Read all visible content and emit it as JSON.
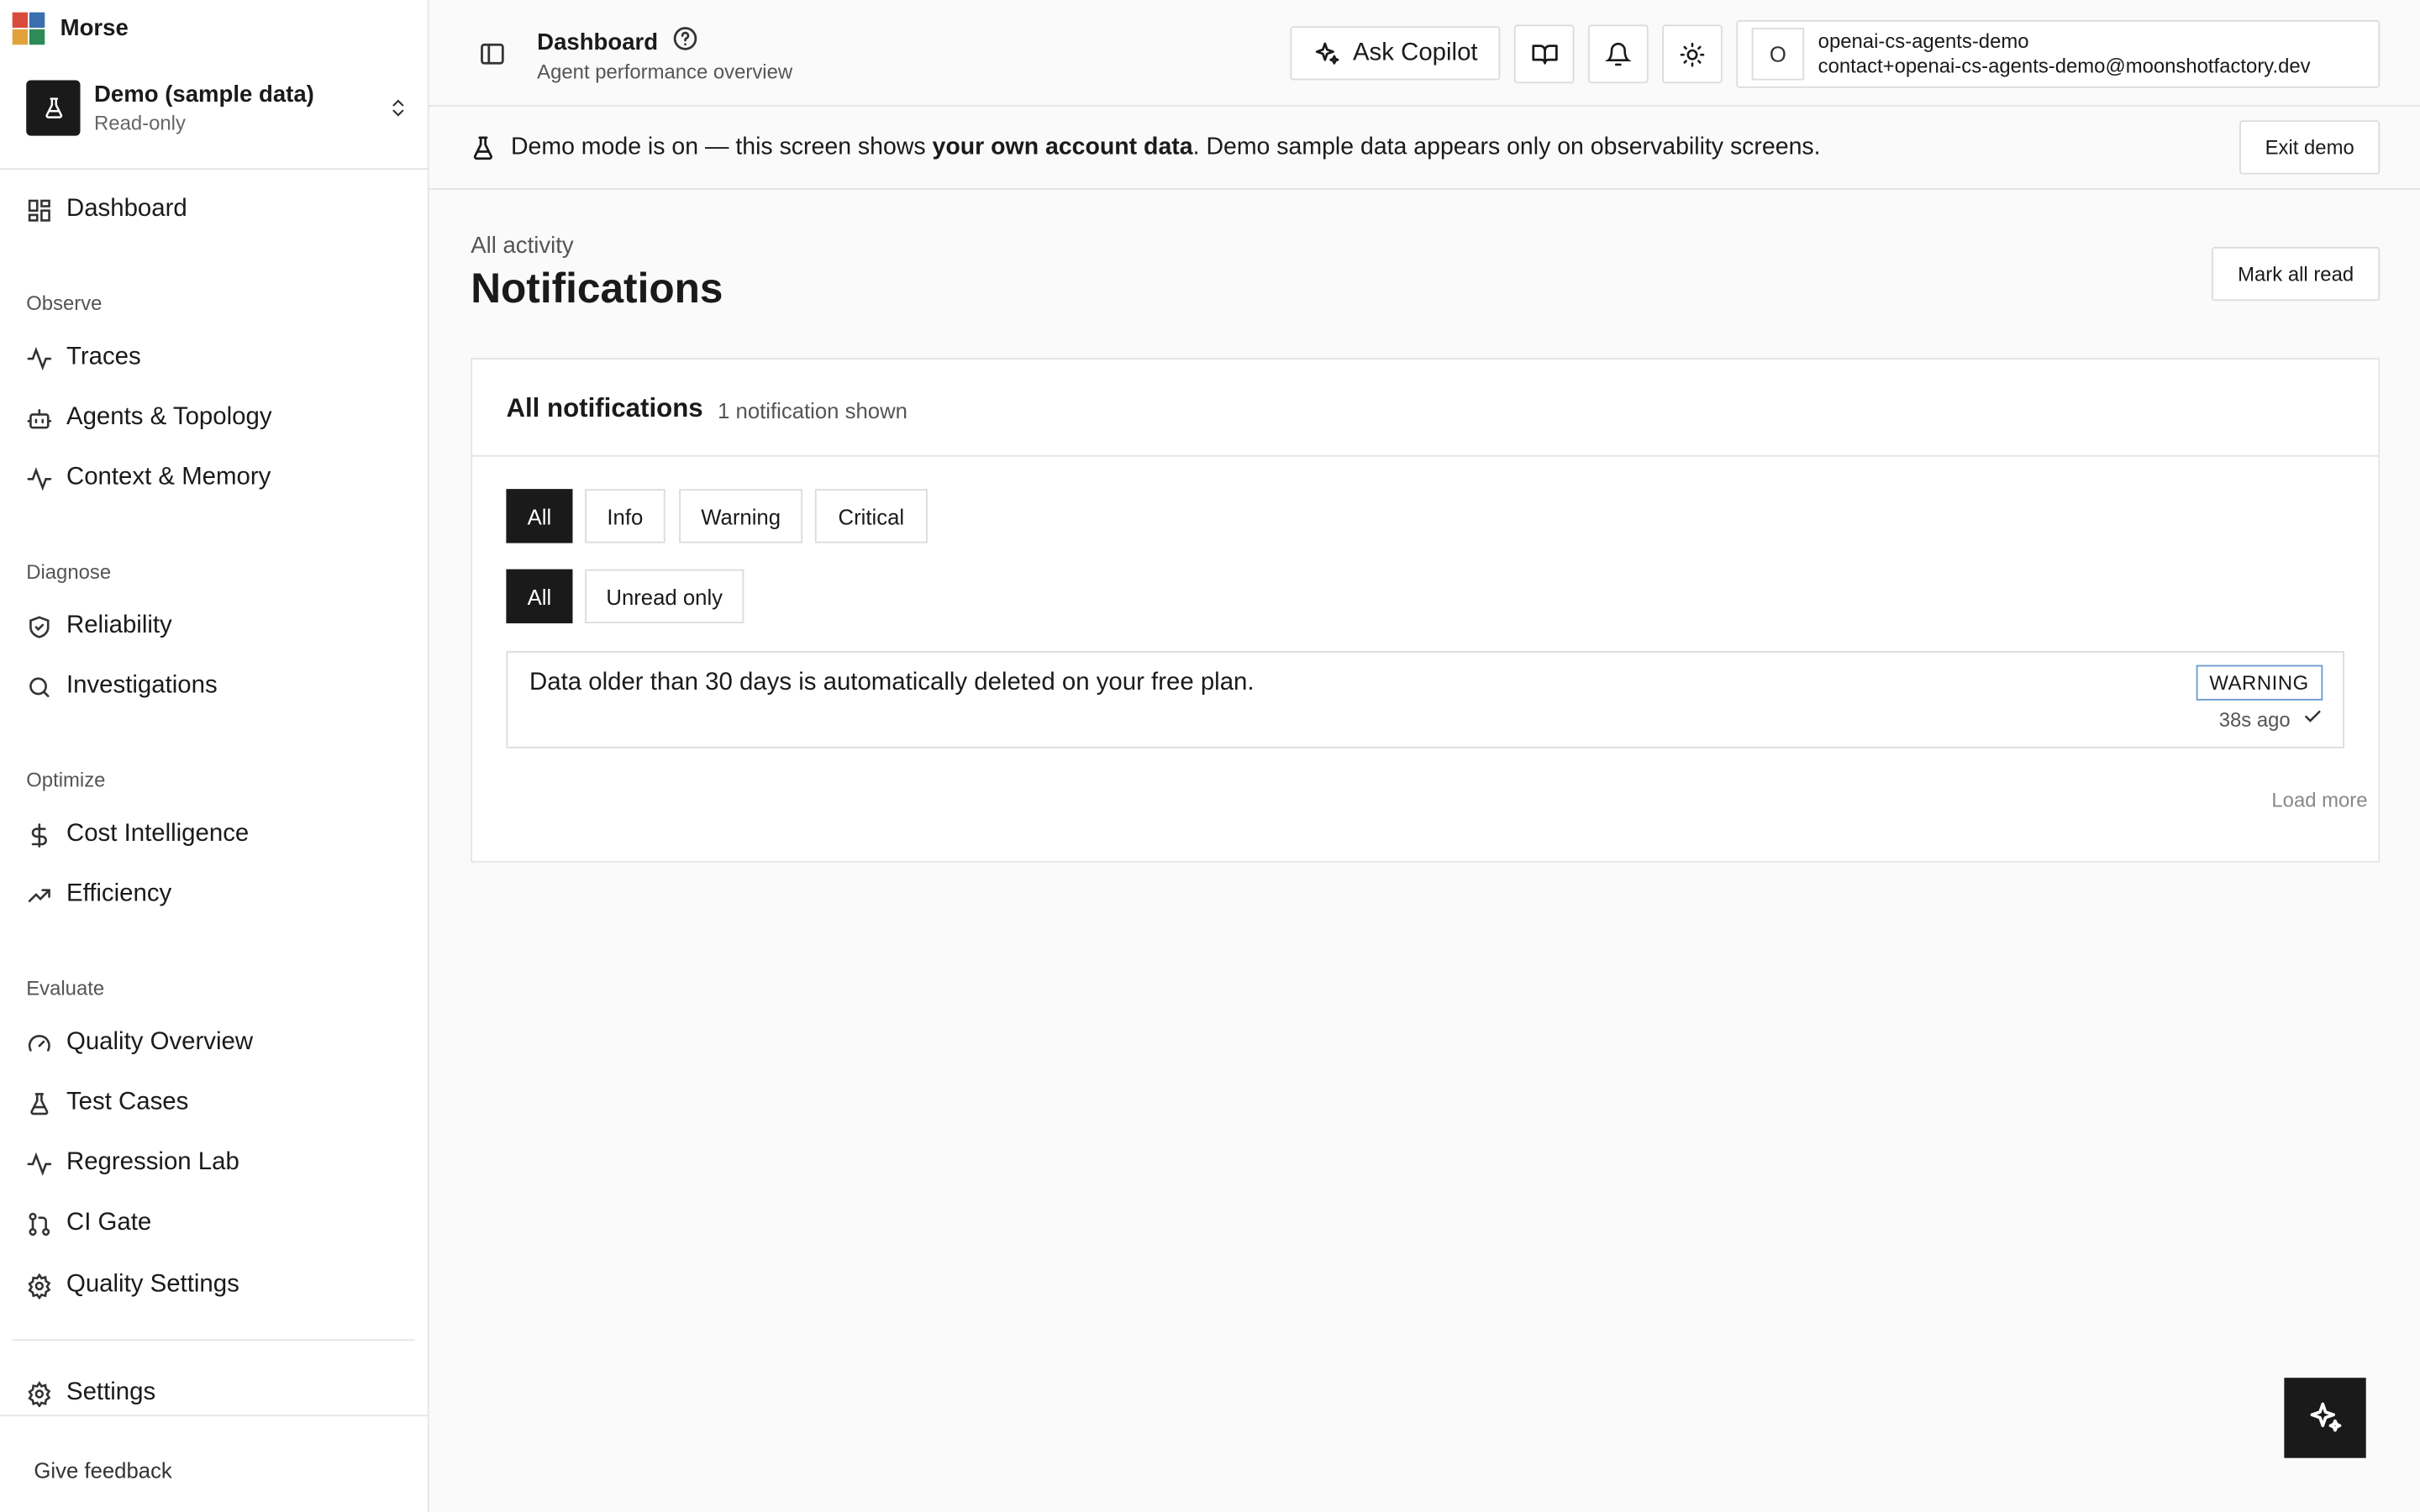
{
  "app": {
    "name": "Morse",
    "logo_colors": [
      "#d94b3d",
      "#3a6fb0",
      "#e0a33a",
      "#2e8b57"
    ]
  },
  "workspace": {
    "name": "Demo (sample data)",
    "subtitle": "Read-only"
  },
  "nav": {
    "dashboard": "Dashboard",
    "sections": [
      "Observe",
      "Diagnose",
      "Optimize",
      "Evaluate"
    ],
    "observe": [
      "Traces",
      "Agents & Topology",
      "Context & Memory"
    ],
    "diagnose": [
      "Reliability",
      "Investigations"
    ],
    "optimize": [
      "Cost Intelligence",
      "Efficiency"
    ],
    "evaluate": [
      "Quality Overview",
      "Test Cases",
      "Regression Lab",
      "CI Gate",
      "Quality Settings"
    ],
    "settings": "Settings",
    "feedback": "Give feedback"
  },
  "topbar": {
    "title": "Dashboard",
    "subtitle": "Agent performance overview",
    "copilot_label": "Ask Copilot",
    "user": {
      "initial": "O",
      "name": "openai-cs-agents-demo",
      "email": "contact+openai-cs-agents-demo@moonshotfactory.dev"
    }
  },
  "banner": {
    "text_before": "Demo mode is on — this screen shows ",
    "text_bold": "your own account data",
    "text_after": ". Demo sample data appears only on observability screens.",
    "exit_label": "Exit demo"
  },
  "page": {
    "breadcrumb": "All activity",
    "title": "Notifications",
    "mark_all_label": "Mark all read"
  },
  "notifications": {
    "card_title": "All notifications",
    "count_text": "1 notification shown",
    "severity_filters": [
      "All",
      "Info",
      "Warning",
      "Critical"
    ],
    "severity_selected": "All",
    "read_filters": [
      "All",
      "Unread only"
    ],
    "read_selected": "All",
    "items": [
      {
        "message": "Data older than 30 days is automatically deleted on your free plan.",
        "severity": "WARNING",
        "time": "38s ago",
        "badge_border": "#6b9bd0"
      }
    ],
    "load_more": "Load more"
  }
}
